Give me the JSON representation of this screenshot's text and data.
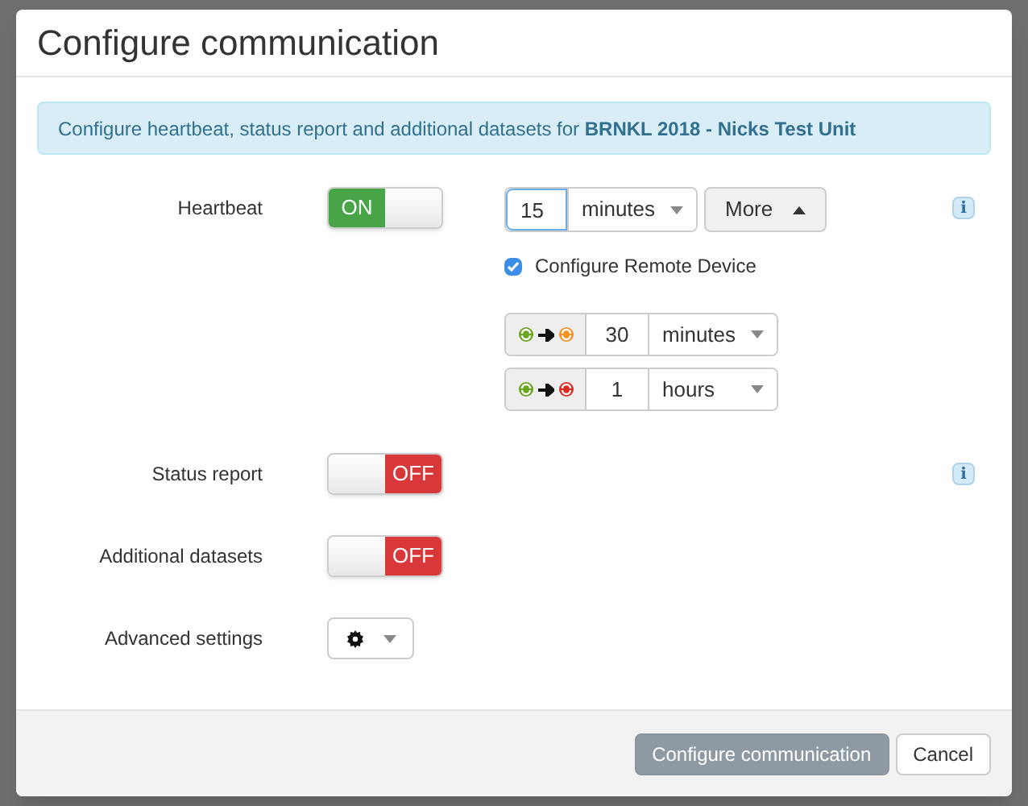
{
  "dialog": {
    "title": "Configure communication"
  },
  "alert": {
    "text": "Configure heartbeat, status report and additional datasets for **BRNKL 2018 - Nicks Test Unit**"
  },
  "rows": [
    {
      "kind": "toggle",
      "label": "Heartbeat",
      "on": true,
      "switch_text": "ON",
      "info": "i",
      "details": {
        "interval": {
          "value": "15",
          "unit": "minutes"
        },
        "more_button": "More",
        "remote": {
          "label": "Configure Remote Device",
          "checked": true
        },
        "remote_intervals": [
          {
            "value": "30",
            "unit": "minutes",
            "color": "#f39322"
          },
          {
            "value": "1",
            "unit": "hours",
            "color": "#dd2b22"
          }
        ]
      }
    },
    {
      "kind": "toggle",
      "label": "Status report",
      "on": false,
      "switch_text": "OFF",
      "info": "i"
    },
    {
      "kind": "toggle",
      "label": "Additional datasets",
      "on": false,
      "switch_text": "OFF"
    },
    {
      "kind": "menu",
      "label": "Advanced settings"
    }
  ],
  "footer": {
    "buttons": [
      {
        "label": "Configure communication",
        "kind": "primary"
      },
      {
        "label": "Cancel",
        "kind": "default"
      }
    ]
  }
}
